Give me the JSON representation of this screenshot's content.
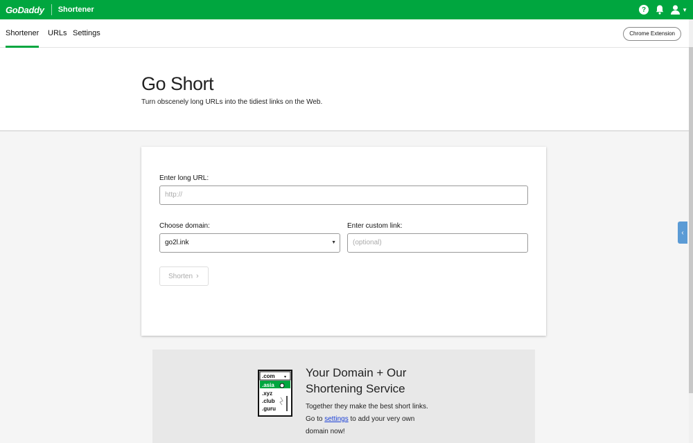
{
  "header": {
    "logo": "GoDaddy",
    "app_name": "Shortener",
    "help_icon_glyph": "?"
  },
  "subnav": {
    "tabs": [
      {
        "label": "Shortener",
        "active": true
      },
      {
        "label": "URLs",
        "active": false
      },
      {
        "label": "Settings",
        "active": false
      }
    ],
    "chrome_extension_label": "Chrome Extension"
  },
  "hero": {
    "title": "Go Short",
    "subtitle": "Turn obscenely long URLs into the tidiest links on the Web."
  },
  "form": {
    "long_url_label": "Enter long URL:",
    "long_url_placeholder": "http://",
    "domain_label": "Choose domain:",
    "domain_value": "go2l.ink",
    "custom_link_label": "Enter custom link:",
    "custom_link_placeholder": "(optional)",
    "shorten_label": "Shorten"
  },
  "promo": {
    "title": "Your Domain + Our Shortening Service",
    "text_before_link": "Together they make the best short links. Go to ",
    "link_text": "settings",
    "text_after_link": " to add your very own domain now!",
    "illustration_items": [
      ".com",
      ".asia",
      ".xyz",
      ".club",
      ".guru"
    ]
  },
  "colors": {
    "brand_green": "#00a63f",
    "side_handle": "#5b9bd5",
    "link_blue": "#1a3fd6"
  }
}
